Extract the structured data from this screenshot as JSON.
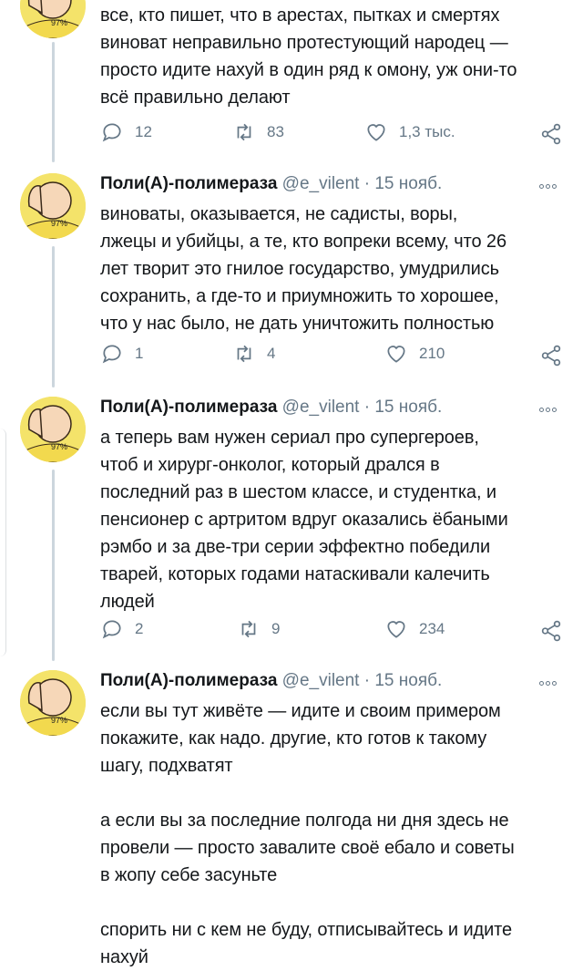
{
  "tweets": [
    {
      "name": "",
      "handle": "",
      "date": "",
      "avatar_badge": "97%",
      "body": "все, кто пишет, что в арестах, пытках и смертях\nвиноват неправильно протестующий народец —\nпросто идите нахуй в один ряд к омону, уж они-то\nвсё правильно делают",
      "replies": "12",
      "retweets": "83",
      "likes": "1,3 тыс."
    },
    {
      "name": "Поли(А)-полимераза",
      "handle": "@e_vilent",
      "date": "15 нояб.",
      "avatar_badge": "97%",
      "body": "виноваты, оказывается, не садисты, воры,\nлжецы и убийцы, а те, кто вопреки всему, что 26\nлет творит это гнилое государство, умудрились\nсохранить, а где-то и приумножить то хорошее,\nчто у нас было, не дать уничтожить полностью",
      "replies": "1",
      "retweets": "4",
      "likes": "210"
    },
    {
      "name": "Поли(А)-полимераза",
      "handle": "@e_vilent",
      "date": "15 нояб.",
      "avatar_badge": "97%",
      "body": "а теперь вам нужен сериал про супергероев,\nчтоб и хирург-онколог, который дрался в\nпоследний раз в шестом классе, и студентка, и\nпенсионер с артритом вдруг оказались ёбаными\nрэмбо и за две-три серии эффектно победили\nтварей, которых годами натаскивали калечить\nлюдей",
      "replies": "2",
      "retweets": "9",
      "likes": "234"
    },
    {
      "name": "Поли(А)-полимераза",
      "handle": "@e_vilent",
      "date": "15 нояб.",
      "avatar_badge": "97%",
      "body": "если вы тут живёте — идите и своим примером\nпокажите, как надо. другие, кто готов к такому\nшагу, подхватят\n\nа если вы за последние полгода ни дня здесь не\nпровели — просто завалите своё ебало и советы\nв жопу себе засуньте\n\nспорить ни с кем не буду, отписывайтесь и идите\nнахуй"
    }
  ],
  "separator_dot": "·",
  "icons": {
    "reply": "reply-icon",
    "retweet": "retweet-icon",
    "like": "heart-icon",
    "share": "share-icon",
    "more": "more-options-icon",
    "avatar": "facepalm-avatar"
  },
  "colors": {
    "text": "#14171a",
    "secondary": "#657786",
    "thread_line": "#ccd6dd",
    "avatar_bg": "#f4e36a"
  }
}
